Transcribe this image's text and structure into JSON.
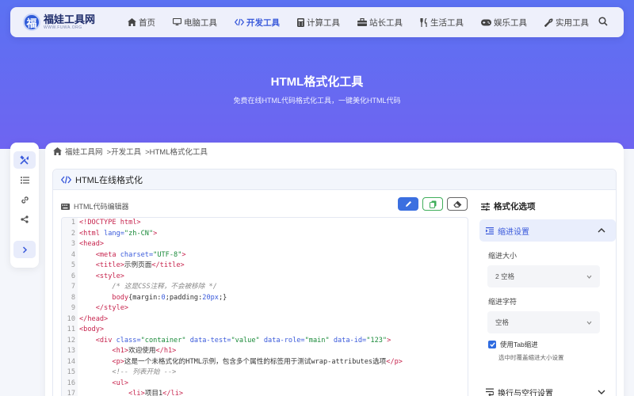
{
  "nav": {
    "logo_title": "福娃工具网",
    "logo_sub": "WWW.FUWA.ORG",
    "logo_char": "福",
    "items": [
      {
        "label": "首页",
        "icon": "home-icon"
      },
      {
        "label": "电脑工具",
        "icon": "monitor-icon"
      },
      {
        "label": "开发工具",
        "icon": "code-icon",
        "active": true
      },
      {
        "label": "计算工具",
        "icon": "calculator-icon"
      },
      {
        "label": "站长工具",
        "icon": "toolbox-icon"
      },
      {
        "label": "生活工具",
        "icon": "utensils-icon"
      },
      {
        "label": "娱乐工具",
        "icon": "gamepad-icon"
      },
      {
        "label": "实用工具",
        "icon": "wrench-icon"
      }
    ]
  },
  "hero": {
    "title": "HTML格式化工具",
    "subtitle": "免费在线HTML代码格式化工具，一键美化HTML代码"
  },
  "breadcrumb": {
    "home": "福娃工具网",
    "category": ">开发工具",
    "current": ">HTML格式化工具"
  },
  "card": {
    "title": "HTML在线格式化",
    "editor_label": "HTML代码编辑器"
  },
  "options": {
    "title": "格式化选项",
    "indent_section": "缩进设置",
    "indent_size_label": "缩进大小",
    "indent_size_value": "2 空格",
    "indent_char_label": "缩进字符",
    "indent_char_value": "空格",
    "use_tab_label": "使用Tab缩进",
    "use_tab_hint": "选中时覆盖缩进大小设置",
    "wrap_section": "换行与空行设置"
  },
  "code_lines": [
    "1",
    "2",
    "3",
    "4",
    "5",
    "6",
    "7",
    "8",
    "9",
    "10",
    "11",
    "12",
    "13",
    "14",
    "15",
    "16",
    "17"
  ],
  "code": {
    "l1": "<!DOCTYPE html>",
    "l2a": "<html ",
    "l2b": "lang=",
    "l2c": "\"zh-CN\"",
    "l2d": ">",
    "l3": "<head>",
    "l4a": "    <meta ",
    "l4b": "charset=",
    "l4c": "\"UTF-8\"",
    "l4d": ">",
    "l5a": "    <title>",
    "l5b": "示例页面",
    "l5c": "</title>",
    "l6": "    <style>",
    "l7": "        /* 这是CSS注释，不会被移除 */",
    "l8a": "        body",
    "l8b": "{margin:",
    "l8c": "0",
    "l8d": ";padding:",
    "l8e": "20px",
    "l8f": ";}",
    "l9": "    </style>",
    "l10": "</head>",
    "l11": "<body>",
    "l12a": "    <div ",
    "l12b": "class=",
    "l12c": "\"container\"",
    "l12d": " data-test=",
    "l12e": "\"value\"",
    "l12f": " data-role=",
    "l12g": "\"main\"",
    "l12h": " data-id=",
    "l12i": "\"123\"",
    "l12j": ">",
    "l13a": "        <h1>",
    "l13b": "欢迎使用",
    "l13c": "</h1>",
    "l14a": "        <p>",
    "l14b": "这是一个未格式化的HTML示例，包含多个属性的标签用于测试wrap-attributes选项",
    "l14c": "</p>",
    "l15": "        <!-- 列表开始 -->",
    "l16": "        <ul>",
    "l17a": "            <li>",
    "l17b": "项目1",
    "l17c": "</li>"
  },
  "colors": {
    "accent": "#3b5bdb",
    "gradient_start": "#5b72f2",
    "gradient_end": "#8d55ee",
    "copy_green": "#3fae5a"
  }
}
